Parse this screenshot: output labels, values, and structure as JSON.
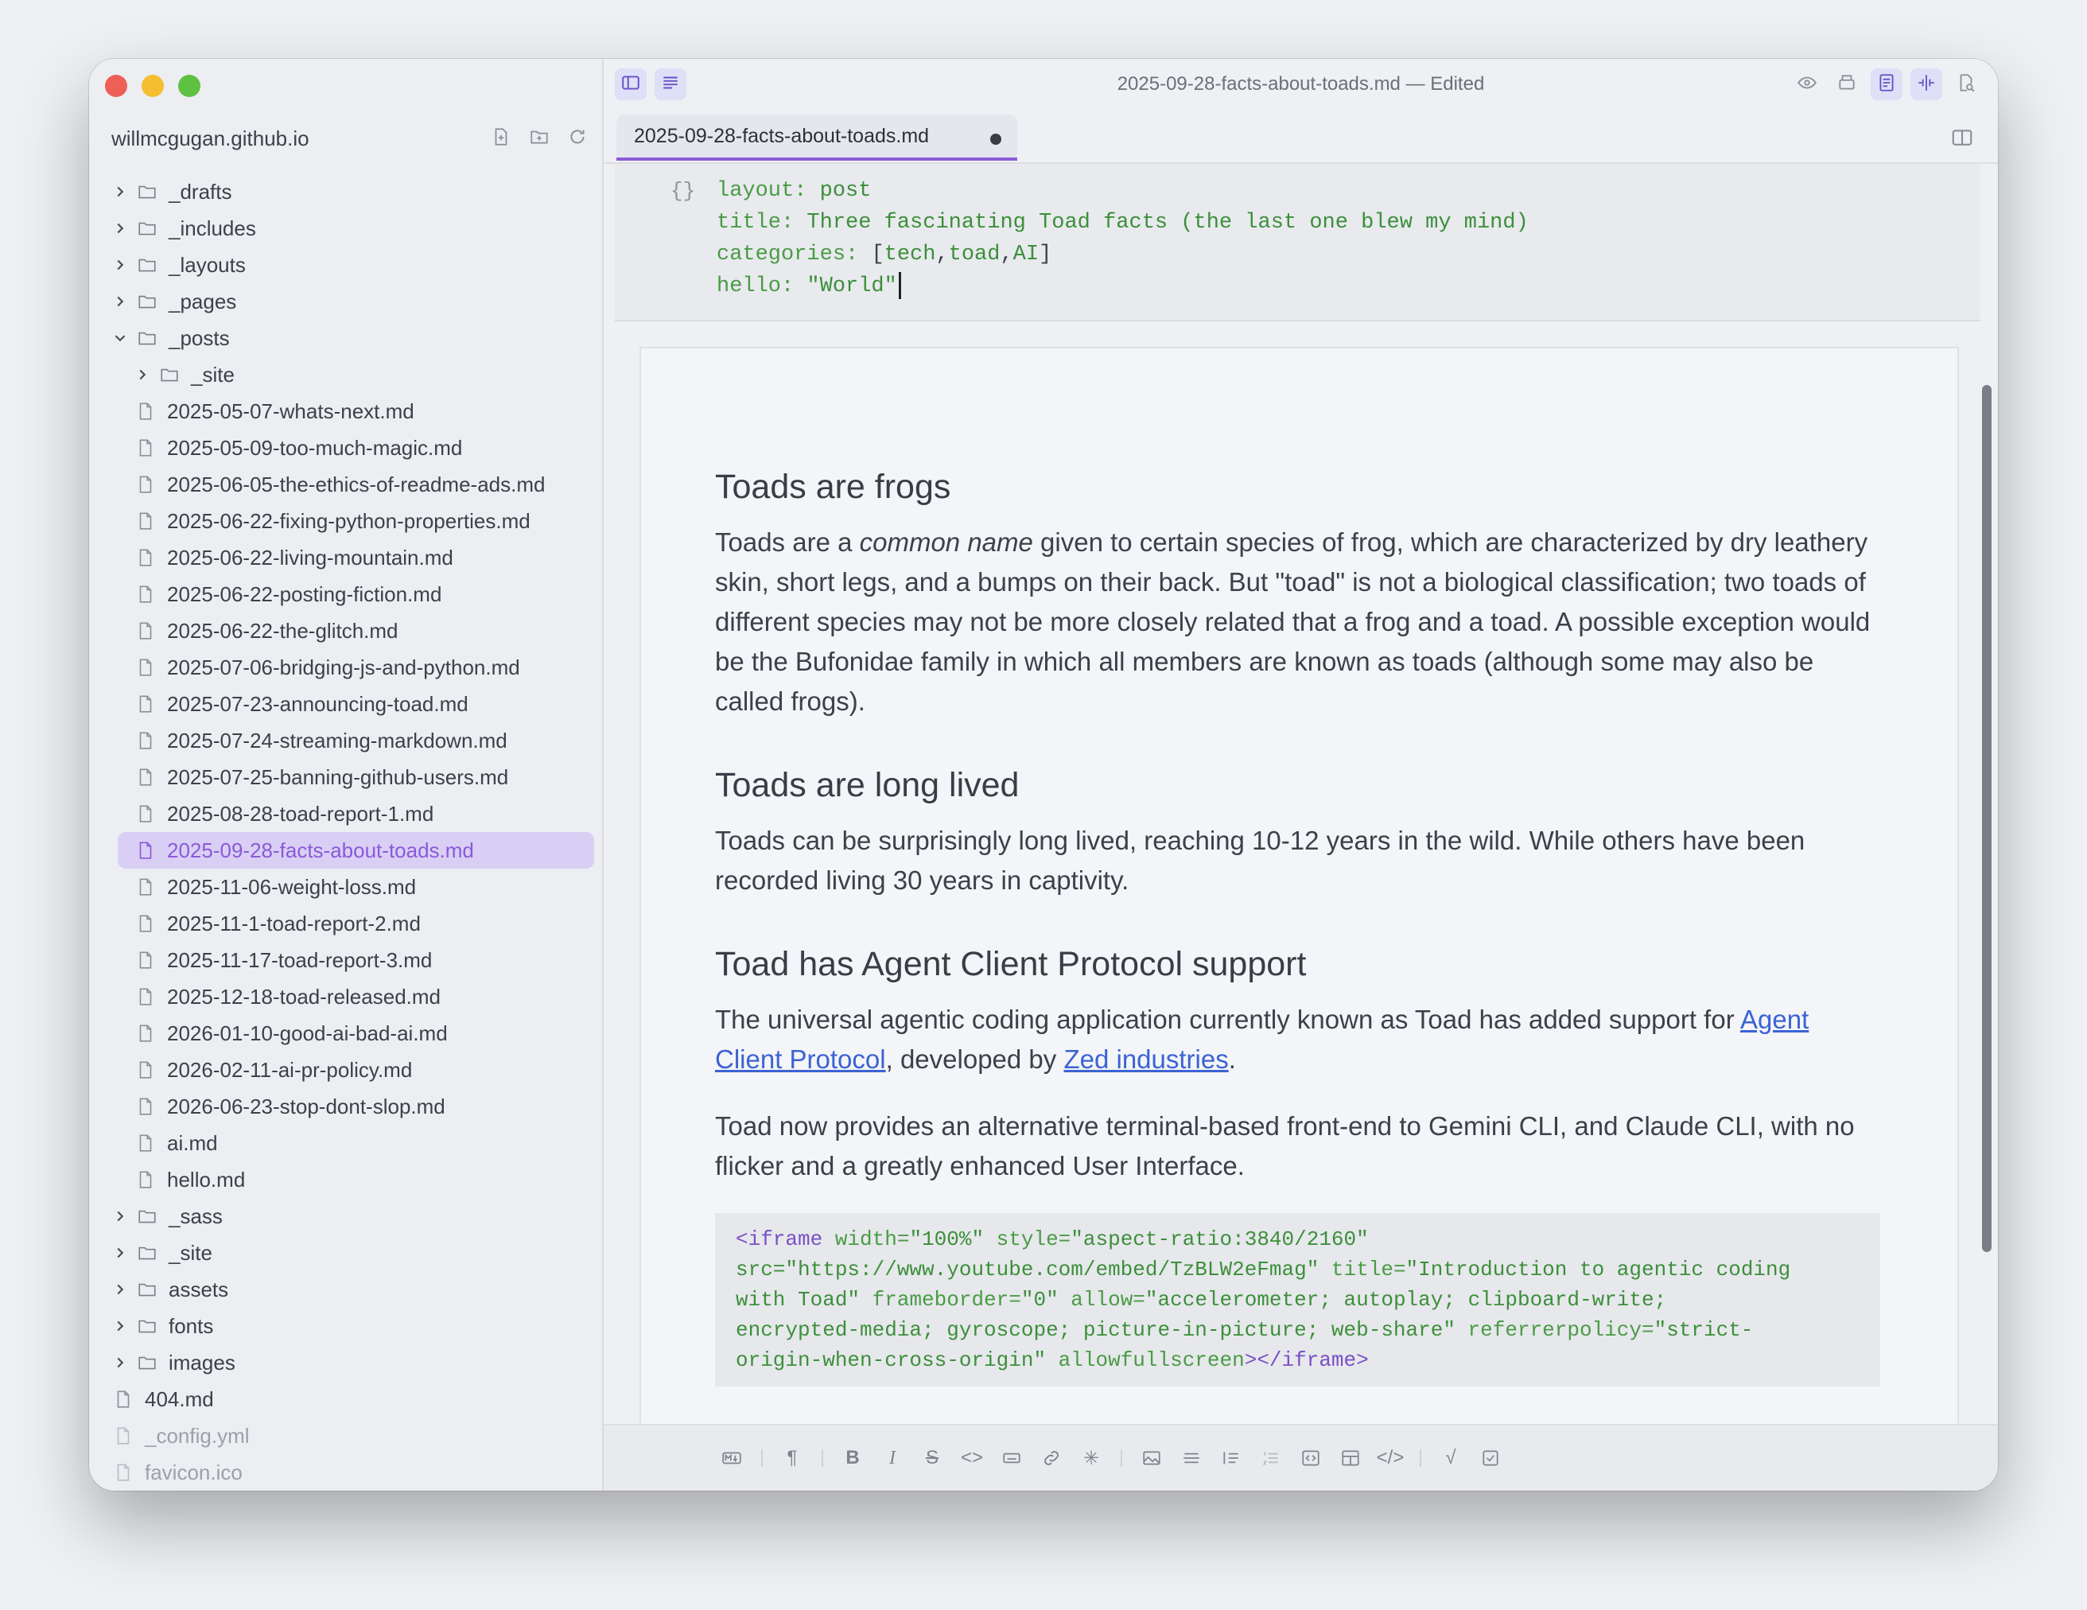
{
  "window": {
    "title": "2025-09-28-facts-about-toads.md",
    "status": "— Edited"
  },
  "sidebar": {
    "project": "willmcgugan.github.io",
    "items": [
      {
        "label": "_drafts",
        "type": "folder",
        "level": 0,
        "expanded": false
      },
      {
        "label": "_includes",
        "type": "folder",
        "level": 0,
        "expanded": false
      },
      {
        "label": "_layouts",
        "type": "folder",
        "level": 0,
        "expanded": false
      },
      {
        "label": "_pages",
        "type": "folder",
        "level": 0,
        "expanded": false
      },
      {
        "label": "_posts",
        "type": "folder",
        "level": 0,
        "expanded": true
      },
      {
        "label": "_site",
        "type": "folder",
        "level": 1,
        "expanded": false
      },
      {
        "label": "2025-05-07-whats-next.md",
        "type": "file",
        "level": 1
      },
      {
        "label": "2025-05-09-too-much-magic.md",
        "type": "file",
        "level": 1
      },
      {
        "label": "2025-06-05-the-ethics-of-readme-ads.md",
        "type": "file",
        "level": 1
      },
      {
        "label": "2025-06-22-fixing-python-properties.md",
        "type": "file",
        "level": 1
      },
      {
        "label": "2025-06-22-living-mountain.md",
        "type": "file",
        "level": 1
      },
      {
        "label": "2025-06-22-posting-fiction.md",
        "type": "file",
        "level": 1
      },
      {
        "label": "2025-06-22-the-glitch.md",
        "type": "file",
        "level": 1
      },
      {
        "label": "2025-07-06-bridging-js-and-python.md",
        "type": "file",
        "level": 1
      },
      {
        "label": "2025-07-23-announcing-toad.md",
        "type": "file",
        "level": 1
      },
      {
        "label": "2025-07-24-streaming-markdown.md",
        "type": "file",
        "level": 1
      },
      {
        "label": "2025-07-25-banning-github-users.md",
        "type": "file",
        "level": 1
      },
      {
        "label": "2025-08-28-toad-report-1.md",
        "type": "file",
        "level": 1
      },
      {
        "label": "2025-09-28-facts-about-toads.md",
        "type": "file",
        "level": 1,
        "selected": true
      },
      {
        "label": "2025-11-06-weight-loss.md",
        "type": "file",
        "level": 1
      },
      {
        "label": "2025-11-1-toad-report-2.md",
        "type": "file",
        "level": 1
      },
      {
        "label": "2025-11-17-toad-report-3.md",
        "type": "file",
        "level": 1
      },
      {
        "label": "2025-12-18-toad-released.md",
        "type": "file",
        "level": 1
      },
      {
        "label": "2026-01-10-good-ai-bad-ai.md",
        "type": "file",
        "level": 1
      },
      {
        "label": "2026-02-11-ai-pr-policy.md",
        "type": "file",
        "level": 1
      },
      {
        "label": "2026-06-23-stop-dont-slop.md",
        "type": "file",
        "level": 1
      },
      {
        "label": "ai.md",
        "type": "file",
        "level": 1
      },
      {
        "label": "hello.md",
        "type": "file",
        "level": 1
      },
      {
        "label": "_sass",
        "type": "folder",
        "level": 0,
        "expanded": false
      },
      {
        "label": "_site",
        "type": "folder",
        "level": 0,
        "expanded": false
      },
      {
        "label": "assets",
        "type": "folder",
        "level": 0,
        "expanded": false
      },
      {
        "label": "fonts",
        "type": "folder",
        "level": 0,
        "expanded": false
      },
      {
        "label": "images",
        "type": "folder",
        "level": 0,
        "expanded": false
      },
      {
        "label": "404.md",
        "type": "file",
        "level": 0
      },
      {
        "label": "_config.yml",
        "type": "file",
        "level": 0,
        "dim": true
      },
      {
        "label": "favicon.ico",
        "type": "file",
        "level": 0,
        "dim": true
      }
    ]
  },
  "tab": {
    "label": "2025-09-28-facts-about-toads.md"
  },
  "frontmatter": {
    "icon": "{}",
    "line1_key": "layout:",
    "line1_val": "post",
    "line2_key": "title:",
    "line2_val": "Three fascinating Toad facts (the last one blew my mind)",
    "line3_key": "categories:",
    "line3_open": "[",
    "line3_a": "tech",
    "line3_comma1": ",",
    "line3_b": "toad",
    "line3_comma2": ",",
    "line3_c": "AI",
    "line3_close": "]",
    "line4_key": "hello:",
    "line4_val": "\"World\""
  },
  "doc": {
    "h1": "Toads are frogs",
    "p1_a": "Toads are a ",
    "p1_em": "common name",
    "p1_b": " given to certain species of frog, which are characterized by dry leathery skin, short legs, and a bumps on their back. But \"toad\" is not a biological classification; two toads of different species may not be more closely related that a frog and a toad. A possible exception would be the Bufonidae family in which all members are known as toads (although some may also be called frogs).",
    "h2": "Toads are long lived",
    "p2": "Toads can be surprisingly long lived, reaching 10-12 years in the wild. While others have been recorded living 30 years in captivity.",
    "h3": "Toad has Agent Client Protocol support",
    "p3_a": "The universal agentic coding application currently known as Toad has added support for ",
    "p3_link1": "Agent Client Protocol",
    "p3_b": ", developed by ",
    "p3_link2": "Zed industries",
    "p3_c": ".",
    "p4": "Toad now provides an alternative terminal-based front-end to Gemini CLI, and Claude CLI, with no flicker and a greatly enhanced User Interface.",
    "code": {
      "t1": "<iframe",
      "a1": " width=",
      "s1": "\"100%\"",
      "a2": " style=",
      "s2": "\"aspect-ratio:3840/2160\"",
      "s3": "src=\"https://www.youtube.com/embed/TzBLW2eFmag\"",
      "a3": " title=",
      "s4": "\"Introduction to agentic coding",
      "s5": "with Toad\"",
      "a4": " frameborder=",
      "s6": "\"0\"",
      "a5": " allow=",
      "s7": "\"accelerometer; autoplay; clipboard-write;",
      "s8": "encrypted-media; gyroscope; picture-in-picture; web-share\"",
      "a6": " referrerpolicy=",
      "s9": "\"strict-",
      "s10": "origin-when-cross-origin\"",
      "a7": " allowfullscreen",
      "t2": "></iframe>"
    }
  },
  "toolbar_icons": [
    "md-source-icon",
    "paragraph-icon",
    "bold-icon",
    "italic-icon",
    "strikethrough-icon",
    "inline-code-icon",
    "keyboard-icon",
    "link-icon",
    "asterisk-icon",
    "image-icon",
    "hr-icon",
    "list-icon",
    "ordered-list-icon",
    "code-block-icon",
    "table-icon",
    "html-icon",
    "math-icon",
    "checkbox-icon"
  ]
}
